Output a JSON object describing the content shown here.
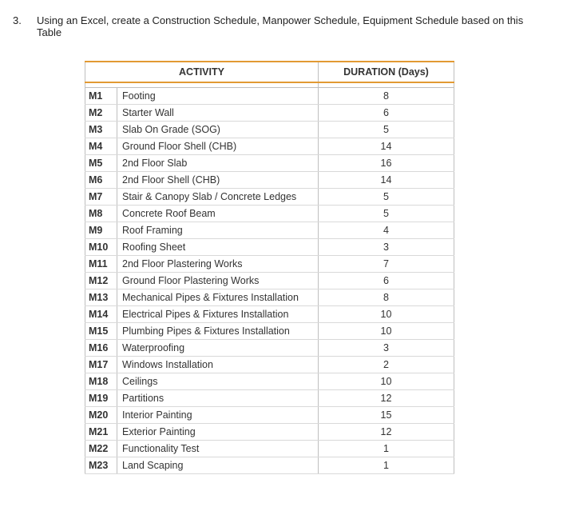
{
  "question": {
    "number": "3.",
    "text": "Using an Excel, create a Construction Schedule, Manpower Schedule, Equipment Schedule based on this Table"
  },
  "table": {
    "headers": {
      "activity": "ACTIVITY",
      "duration": "DURATION (Days)"
    },
    "rows": [
      {
        "code": "M1",
        "activity": "Footing",
        "duration": "8"
      },
      {
        "code": "M2",
        "activity": "Starter Wall",
        "duration": "6"
      },
      {
        "code": "M3",
        "activity": "Slab On Grade (SOG)",
        "duration": "5"
      },
      {
        "code": "M4",
        "activity": "Ground Floor Shell (CHB)",
        "duration": "14"
      },
      {
        "code": "M5",
        "activity": "2nd Floor Slab",
        "duration": "16"
      },
      {
        "code": "M6",
        "activity": "2nd Floor Shell (CHB)",
        "duration": "14"
      },
      {
        "code": "M7",
        "activity": "Stair & Canopy Slab / Concrete Ledges",
        "duration": "5"
      },
      {
        "code": "M8",
        "activity": "Concrete Roof Beam",
        "duration": "5"
      },
      {
        "code": "M9",
        "activity": "Roof Framing",
        "duration": "4"
      },
      {
        "code": "M10",
        "activity": "Roofing Sheet",
        "duration": "3"
      },
      {
        "code": "M11",
        "activity": "2nd Floor Plastering Works",
        "duration": "7"
      },
      {
        "code": "M12",
        "activity": "Ground Floor Plastering Works",
        "duration": "6"
      },
      {
        "code": "M13",
        "activity": "Mechanical Pipes & Fixtures Installation",
        "duration": "8"
      },
      {
        "code": "M14",
        "activity": "Electrical Pipes & Fixtures Installation",
        "duration": "10"
      },
      {
        "code": "M15",
        "activity": "Plumbing Pipes & Fixtures Installation",
        "duration": "10"
      },
      {
        "code": "M16",
        "activity": "Waterproofing",
        "duration": "3"
      },
      {
        "code": "M17",
        "activity": "Windows Installation",
        "duration": "2"
      },
      {
        "code": "M18",
        "activity": "Ceilings",
        "duration": "10"
      },
      {
        "code": "M19",
        "activity": "Partitions",
        "duration": "12"
      },
      {
        "code": "M20",
        "activity": "Interior Painting",
        "duration": "15"
      },
      {
        "code": "M21",
        "activity": "Exterior Painting",
        "duration": "12"
      },
      {
        "code": "M22",
        "activity": "Functionality Test",
        "duration": "1"
      },
      {
        "code": "M23",
        "activity": "Land Scaping",
        "duration": "1"
      }
    ]
  }
}
